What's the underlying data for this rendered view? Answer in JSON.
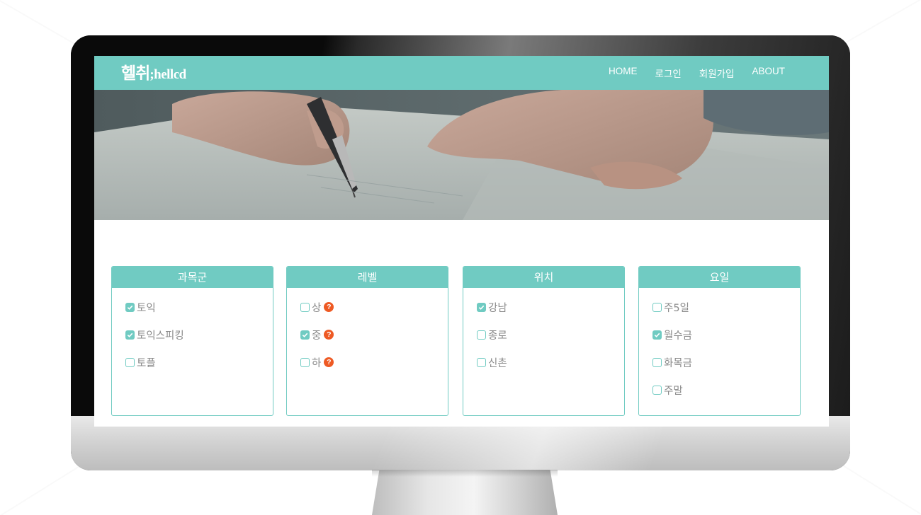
{
  "brand": {
    "logo_korean": "헬취",
    "logo_english": ";hellcd"
  },
  "nav": {
    "items": [
      {
        "label": "HOME"
      },
      {
        "label": "로그인"
      },
      {
        "label": "회원가입"
      },
      {
        "label": "ABOUT"
      }
    ]
  },
  "colors": {
    "accent": "#70cbc2",
    "help_badge": "#ee5a24",
    "option_text": "#8a8a8a"
  },
  "filters": [
    {
      "title": "과목군",
      "options": [
        {
          "label": "토익",
          "checked": true,
          "help": false
        },
        {
          "label": "토익스피킹",
          "checked": true,
          "help": false
        },
        {
          "label": "토플",
          "checked": false,
          "help": false
        }
      ]
    },
    {
      "title": "레벨",
      "options": [
        {
          "label": "상",
          "checked": false,
          "help": true
        },
        {
          "label": "중",
          "checked": true,
          "help": true
        },
        {
          "label": "하",
          "checked": false,
          "help": true
        }
      ]
    },
    {
      "title": "위치",
      "options": [
        {
          "label": "강남",
          "checked": true,
          "help": false
        },
        {
          "label": "종로",
          "checked": false,
          "help": false
        },
        {
          "label": "신촌",
          "checked": false,
          "help": false
        }
      ]
    },
    {
      "title": "요일",
      "options": [
        {
          "label": "주5일",
          "checked": false,
          "help": false
        },
        {
          "label": "월수금",
          "checked": true,
          "help": false
        },
        {
          "label": "화목금",
          "checked": false,
          "help": false
        },
        {
          "label": "주말",
          "checked": false,
          "help": false
        }
      ]
    }
  ],
  "icons": {
    "checkbox_checked": "check-icon",
    "help": "question-circle-icon"
  }
}
